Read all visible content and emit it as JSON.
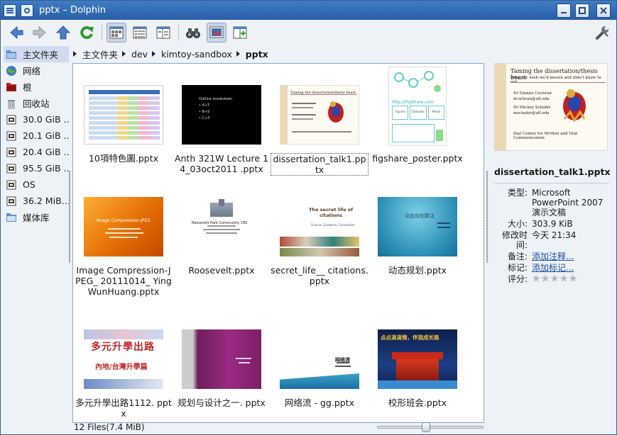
{
  "window": {
    "title": "pptx – Dolphin"
  },
  "toolbar": {
    "buttons": [
      {
        "name": "back-button",
        "icon": "arrow-left-icon",
        "color": "#4a7ec8"
      },
      {
        "name": "forward-button",
        "icon": "arrow-right-icon",
        "color": "#a9b0ba"
      },
      {
        "name": "up-button",
        "icon": "arrow-up-icon",
        "color": "#4a7ec8"
      },
      {
        "name": "reload-button",
        "icon": "reload-icon",
        "color": "#2e9a2e"
      },
      {
        "name": "icons-view-button",
        "icon": "icons-view-icon",
        "pressed": true
      },
      {
        "name": "details-view-button",
        "icon": "details-view-icon"
      },
      {
        "name": "columns-view-button",
        "icon": "columns-view-icon"
      },
      {
        "name": "find-button",
        "icon": "binoculars-icon"
      },
      {
        "name": "preview-button",
        "icon": "preview-icon",
        "pressed": true
      },
      {
        "name": "split-button",
        "icon": "split-icon"
      },
      {
        "name": "settings-button",
        "icon": "wrench-icon"
      }
    ]
  },
  "places": [
    {
      "label": "主文件夹",
      "icon": "home-folder-icon",
      "color": "#5b8fd0",
      "selected": true
    },
    {
      "label": "网络",
      "icon": "network-globe-icon",
      "color": "#3a7ac7"
    },
    {
      "label": "根",
      "icon": "root-folder-icon",
      "color": "#c41e1e"
    },
    {
      "label": "回收站",
      "icon": "trash-icon",
      "color": "#c7ccd3"
    },
    {
      "label": "30.0 GiB …",
      "icon": "drive-icon",
      "color": "#444"
    },
    {
      "label": "20.1 GiB …",
      "icon": "drive-icon",
      "color": "#444"
    },
    {
      "label": "20.4 GiB …",
      "icon": "drive-icon",
      "color": "#444"
    },
    {
      "label": "95.5 GiB …",
      "icon": "drive-icon",
      "color": "#444"
    },
    {
      "label": "OS",
      "icon": "drive-icon",
      "color": "#444"
    },
    {
      "label": "36.2 MiB…",
      "icon": "drive-icon",
      "color": "#444"
    },
    {
      "label": "媒体库",
      "icon": "media-folder-icon",
      "color": "#5b8fd0"
    }
  ],
  "breadcrumb": [
    "主文件夹",
    "dev",
    "kimtoy-sandbox",
    "pptx"
  ],
  "files": [
    {
      "name": "10項特色圖.pptx",
      "thumb": "table"
    },
    {
      "name": "Anth 321W Lecture 14_03oct2011 .pptx",
      "thumb": "black"
    },
    {
      "name": "dissertation_talk1.pptx",
      "thumb": "dissertation",
      "selected": true
    },
    {
      "name": "figshare_poster.pptx",
      "thumb": "figshare"
    },
    {
      "name": "Image Compression-JPEG_ 20111014_ YingWunHuang.pptx",
      "thumb": "orange"
    },
    {
      "name": "Roosevelt.pptx",
      "thumb": "roosevelt"
    },
    {
      "name": "secret_life__ citations.pptx",
      "thumb": "secret"
    },
    {
      "name": "动态规划.pptx",
      "thumb": "teal"
    },
    {
      "name": "多元升學出路1112. pptx",
      "thumb": "duoyuan"
    },
    {
      "name": "规划与设计之一. pptx",
      "thumb": "purple"
    },
    {
      "name": "网络流 - gg.pptx",
      "thumb": "wangluo"
    },
    {
      "name": "校形班会.pptx",
      "thumb": "night"
    }
  ],
  "thumb_text": {
    "anth": [
      "Outline breakdown",
      "• A+T",
      "• B+S",
      "• C+3"
    ],
    "dissertation_title": "Taming the dissertation/thesis beast",
    "dissertation_sub": "What we wish we'd known and didn't know to ask",
    "dissertation_names": [
      "Dr Dianne Cochran",
      "dcochran@ufl.edu",
      "Dr Mickey Schafer",
      "mschafer@ufl.edu"
    ],
    "dissertation_footer": "Dial Center for Written and Oral Communication",
    "figshare": "http://FigShare.com",
    "figshare_boxes": [
      "Figures",
      "Datasets",
      "Media"
    ],
    "image_compression": "Image Compression-JPEG",
    "roosevelt": "Roosevelt Park Community CRC",
    "secret_title": "The secret life of citations",
    "secret_sub": "Science, Evidence, Connection",
    "teal_title": "动态规划算法",
    "duoyuan_title": "多元升學出路",
    "duoyuan_sub": "內地/台灣升學篇",
    "wangluo_title": "网络流",
    "night_title": "点点滴滴情，伴我成长路"
  },
  "status": {
    "text": "12 Files(7.4 MiB)"
  },
  "zoom": {
    "level": 0.45
  },
  "info": {
    "name": "dissertation_talk1.pptx",
    "meta": [
      {
        "key": "类型:",
        "value": "Microsoft PowerPoint 2007 演示文稿"
      },
      {
        "key": "大小:",
        "value": "303.9 KiB"
      },
      {
        "key": "修改时间:",
        "value": "今天 21:34"
      },
      {
        "key": "备注:",
        "value": "添加注释...",
        "link": true
      },
      {
        "key": "标记:",
        "value": "添加标记...",
        "link": true
      },
      {
        "key": "评分:",
        "value": "",
        "rating": 0
      }
    ]
  }
}
